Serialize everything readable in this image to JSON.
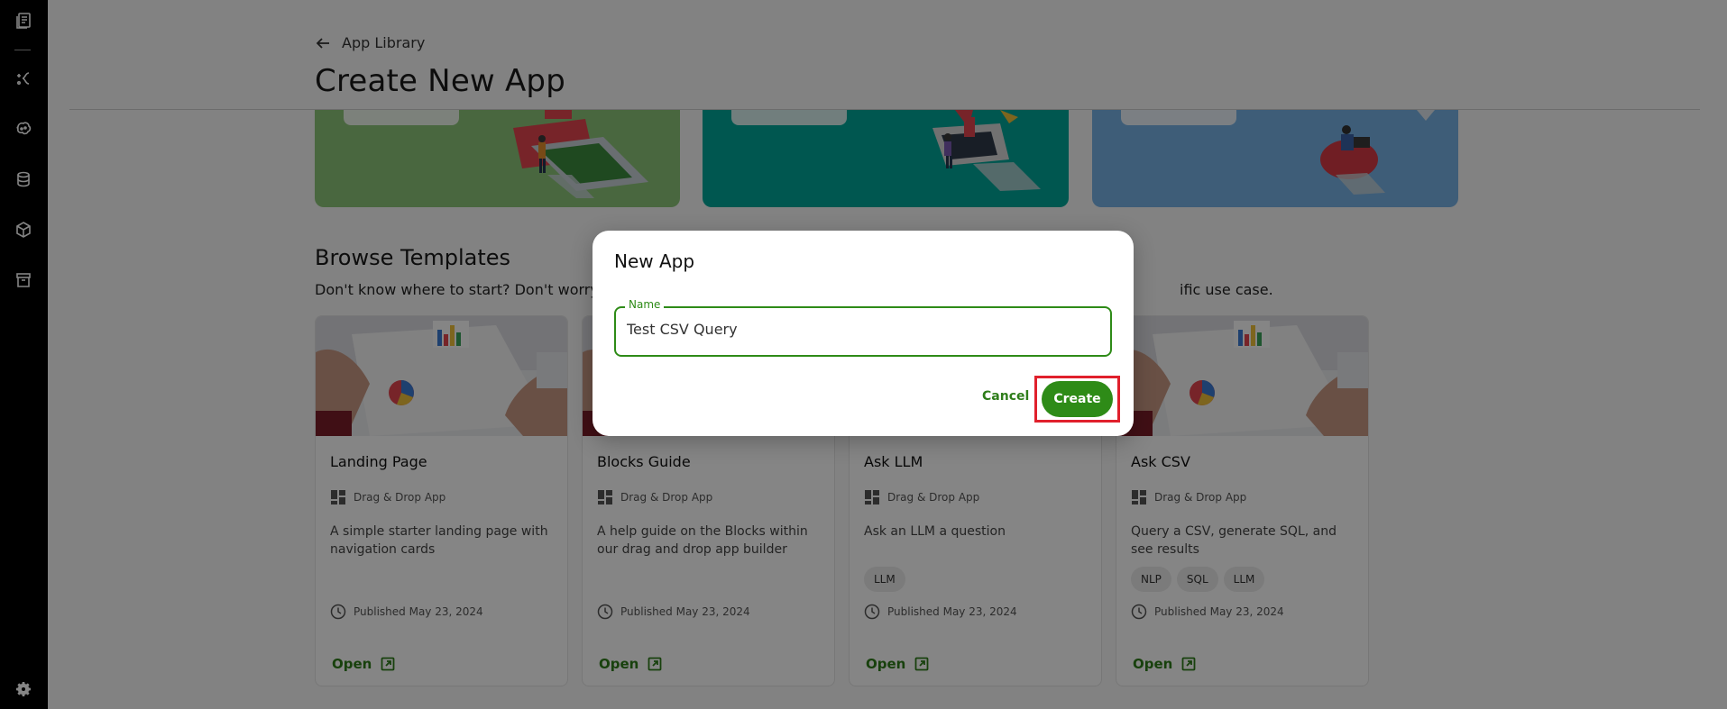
{
  "sidebar": {
    "items": [
      {
        "icon": "notebook-icon"
      },
      {
        "icon": "workflow-icon"
      },
      {
        "icon": "brain-icon"
      },
      {
        "icon": "database-icon"
      },
      {
        "icon": "cube-icon"
      },
      {
        "icon": "archive-icon"
      }
    ],
    "settings_icon": "gear-icon"
  },
  "header": {
    "back_label": "App Library",
    "title": "Create New App"
  },
  "banners": [
    {
      "color": "#8dc679"
    },
    {
      "color": "#00a899"
    },
    {
      "color": "#77b3e6"
    }
  ],
  "templates": {
    "title": "Browse Templates",
    "subtitle_start": "Don't know where to start? Don't worry!",
    "subtitle_end": "ific use case.",
    "cards": [
      {
        "title": "Landing Page",
        "type": "Drag & Drop App",
        "description": "A simple starter landing page with navigation cards",
        "tags": [],
        "published": "Published May 23, 2024",
        "open_label": "Open"
      },
      {
        "title": "Blocks Guide",
        "type": "Drag & Drop App",
        "description": "A help guide on the Blocks within our drag and drop app builder",
        "tags": [],
        "published": "Published May 23, 2024",
        "open_label": "Open"
      },
      {
        "title": "Ask LLM",
        "type": "Drag & Drop App",
        "description": "Ask an LLM a question",
        "tags": [
          "LLM"
        ],
        "published": "Published May 23, 2024",
        "open_label": "Open"
      },
      {
        "title": "Ask CSV",
        "type": "Drag & Drop App",
        "description": "Query a CSV, generate SQL, and see results",
        "tags": [
          "NLP",
          "SQL",
          "LLM"
        ],
        "published": "Published May 23, 2024",
        "open_label": "Open"
      }
    ]
  },
  "dialog": {
    "title": "New App",
    "name_label": "Name",
    "name_value": "Test CSV Query",
    "cancel_label": "Cancel",
    "create_label": "Create"
  },
  "colors": {
    "accent": "#2e8b17",
    "highlight": "#e0202c",
    "sidebar": "#000000"
  }
}
